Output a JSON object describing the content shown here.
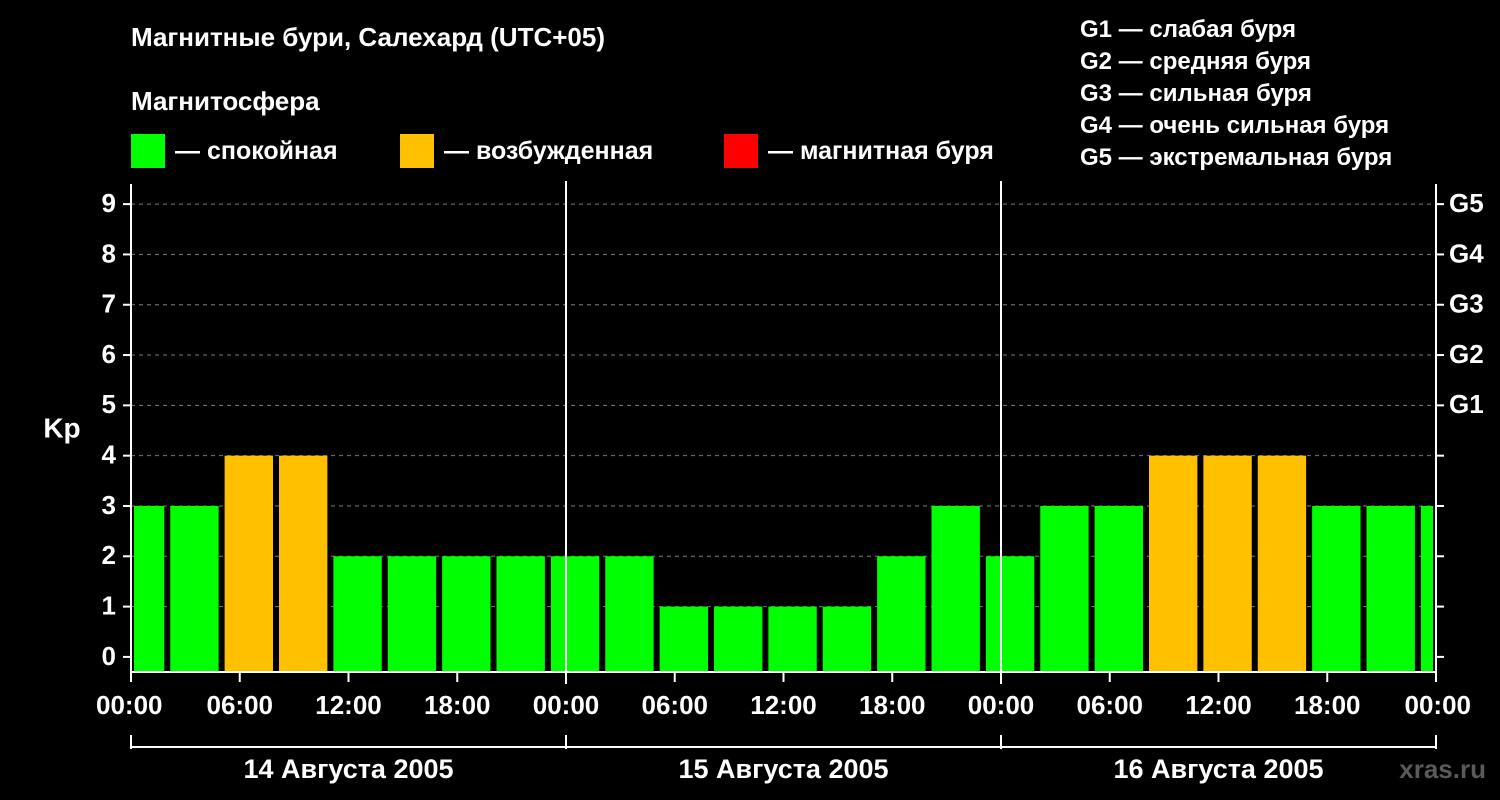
{
  "title": "Магнитные бури, Салехард (UTC+05)",
  "subtitle": "Магнитосфера",
  "legend": [
    {
      "label": "— спокойная",
      "color": "#00ff00"
    },
    {
      "label": "— возбужденная",
      "color": "#ffc000"
    },
    {
      "label": "— магнитная буря",
      "color": "#ff0000"
    }
  ],
  "g_legend": [
    "G1 — слабая буря",
    "G2 — средняя буря",
    "G3 — сильная буря",
    "G4 — очень сильная буря",
    "G5 — экстремальная буря"
  ],
  "watermark": "xras.ru",
  "chart_data": {
    "type": "bar",
    "ylabel": "Kp",
    "ylim": [
      -0.3,
      9.4
    ],
    "yticks": [
      0,
      1,
      2,
      3,
      4,
      5,
      6,
      7,
      8,
      9
    ],
    "right_ticks": [
      {
        "value": 5,
        "label": "G1"
      },
      {
        "value": 6,
        "label": "G2"
      },
      {
        "value": 7,
        "label": "G3"
      },
      {
        "value": 8,
        "label": "G4"
      },
      {
        "value": 9,
        "label": "G5"
      }
    ],
    "grid": true,
    "xlim_hours": [
      0,
      72
    ],
    "x_tick_labels": [
      "00:00",
      "06:00",
      "12:00",
      "18:00",
      "00:00",
      "06:00",
      "12:00",
      "18:00",
      "00:00",
      "06:00",
      "12:00",
      "18:00",
      "00:00"
    ],
    "days": [
      "14 Августа 2005",
      "15 Августа 2005",
      "16 Августа 2005"
    ],
    "colors": {
      "quiet": "#00ff00",
      "active": "#ffc000",
      "storm": "#ff0000"
    },
    "bars": [
      {
        "start_hour": 0,
        "end_hour": 2,
        "kp": 3,
        "level": "quiet"
      },
      {
        "start_hour": 2,
        "end_hour": 5,
        "kp": 3,
        "level": "quiet"
      },
      {
        "start_hour": 5,
        "end_hour": 8,
        "kp": 4,
        "level": "active"
      },
      {
        "start_hour": 8,
        "end_hour": 11,
        "kp": 4,
        "level": "active"
      },
      {
        "start_hour": 11,
        "end_hour": 14,
        "kp": 2,
        "level": "quiet"
      },
      {
        "start_hour": 14,
        "end_hour": 17,
        "kp": 2,
        "level": "quiet"
      },
      {
        "start_hour": 17,
        "end_hour": 20,
        "kp": 2,
        "level": "quiet"
      },
      {
        "start_hour": 20,
        "end_hour": 23,
        "kp": 2,
        "level": "quiet"
      },
      {
        "start_hour": 23,
        "end_hour": 26,
        "kp": 2,
        "level": "quiet"
      },
      {
        "start_hour": 26,
        "end_hour": 29,
        "kp": 2,
        "level": "quiet"
      },
      {
        "start_hour": 29,
        "end_hour": 32,
        "kp": 1,
        "level": "quiet"
      },
      {
        "start_hour": 32,
        "end_hour": 35,
        "kp": 1,
        "level": "quiet"
      },
      {
        "start_hour": 35,
        "end_hour": 38,
        "kp": 1,
        "level": "quiet"
      },
      {
        "start_hour": 38,
        "end_hour": 41,
        "kp": 1,
        "level": "quiet"
      },
      {
        "start_hour": 41,
        "end_hour": 44,
        "kp": 2,
        "level": "quiet"
      },
      {
        "start_hour": 44,
        "end_hour": 47,
        "kp": 3,
        "level": "quiet"
      },
      {
        "start_hour": 47,
        "end_hour": 50,
        "kp": 2,
        "level": "quiet"
      },
      {
        "start_hour": 50,
        "end_hour": 53,
        "kp": 3,
        "level": "quiet"
      },
      {
        "start_hour": 53,
        "end_hour": 56,
        "kp": 3,
        "level": "quiet"
      },
      {
        "start_hour": 56,
        "end_hour": 59,
        "kp": 4,
        "level": "active"
      },
      {
        "start_hour": 59,
        "end_hour": 62,
        "kp": 4,
        "level": "active"
      },
      {
        "start_hour": 62,
        "end_hour": 65,
        "kp": 4,
        "level": "active"
      },
      {
        "start_hour": 65,
        "end_hour": 68,
        "kp": 3,
        "level": "quiet"
      },
      {
        "start_hour": 68,
        "end_hour": 71,
        "kp": 3,
        "level": "quiet"
      },
      {
        "start_hour": 71,
        "end_hour": 72,
        "kp": 3,
        "level": "quiet"
      }
    ]
  }
}
